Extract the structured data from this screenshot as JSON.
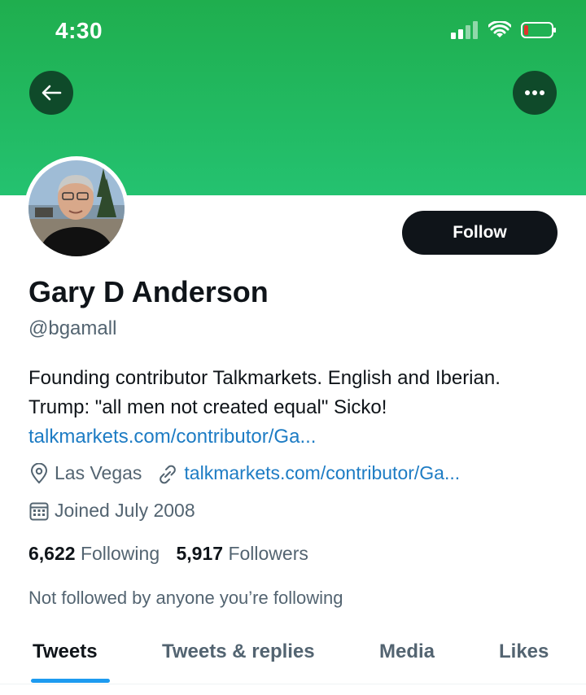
{
  "status_bar": {
    "time": "4:30"
  },
  "profile": {
    "name": "Gary D Anderson",
    "handle": "@bgamall",
    "bio_text": "Founding contributor Talkmarkets. English and Iberian. Trump: \"all men not created equal\" Sicko!",
    "bio_link": "talkmarkets.com/contributor/Ga...",
    "location": "Las Vegas",
    "website": "talkmarkets.com/contributor/Ga...",
    "joined": "Joined July 2008",
    "following_count": "6,622",
    "following_label": "Following",
    "followers_count": "5,917",
    "followers_label": "Followers",
    "follow_context": "Not followed by anyone you’re following"
  },
  "actions": {
    "follow_label": "Follow"
  },
  "tabs": [
    {
      "label": "Tweets",
      "active": true
    },
    {
      "label": "Tweets & replies",
      "active": false
    },
    {
      "label": "Media",
      "active": false
    },
    {
      "label": "Likes",
      "active": false
    }
  ],
  "colors": {
    "banner": "#24c270",
    "link": "#1d7cc4",
    "accent": "#1d9bf0"
  }
}
